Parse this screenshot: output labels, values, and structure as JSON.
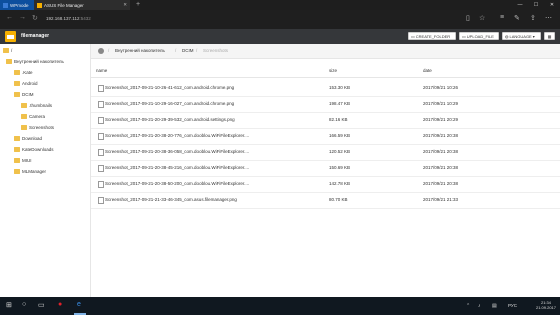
{
  "browser": {
    "tabs": [
      {
        "label": "WPmode"
      },
      {
        "label": "ASUS File Manager"
      }
    ],
    "url": {
      "host": "192.168.137.112",
      "port": ":5432"
    }
  },
  "app": {
    "name": "filemanager",
    "buttons": {
      "create_folder": "CREATE_FOLDER",
      "upload_file": "UPLOAD_FILE",
      "language": "LANGUAGE"
    }
  },
  "sidebar": {
    "root": "/",
    "items": [
      {
        "label": "Внутренний накопитель"
      },
      {
        "label": ".Kate"
      },
      {
        "label": "Android"
      },
      {
        "label": "DCIM"
      },
      {
        "label": ".thumbnails"
      },
      {
        "label": "Camera"
      },
      {
        "label": "Screenshots"
      },
      {
        "label": "Download"
      },
      {
        "label": "KateDownloads"
      },
      {
        "label": "MIUI"
      },
      {
        "label": "MLManager"
      }
    ]
  },
  "breadcrumb": [
    "Внутренний накопитель",
    "DCIM",
    "Screenshots"
  ],
  "table": {
    "headers": {
      "name": "name",
      "size": "size",
      "date": "date"
    },
    "rows": [
      {
        "name": "Screenshot_2017-09-21-10-26-41-612_com.android.chrome.png",
        "size": "153.30 KB",
        "date": "2017/09/21 10:26"
      },
      {
        "name": "Screenshot_2017-09-21-10-29-16-027_com.android.chrome.png",
        "size": "198.47 KB",
        "date": "2017/09/21 10:29"
      },
      {
        "name": "Screenshot_2017-09-21-20-29-39-532_com.android.settings.png",
        "size": "82.16 KB",
        "date": "2017/09/21 20:29"
      },
      {
        "name": "Screenshot_2017-09-21-20-38-20-776_com.dooblou.WiFiFileExplorer....",
        "size": "166.59 KB",
        "date": "2017/09/21 20:38"
      },
      {
        "name": "Screenshot_2017-09-21-20-38-36-058_com.dooblou.WiFiFileExplorer....",
        "size": "120.52 KB",
        "date": "2017/09/21 20:38"
      },
      {
        "name": "Screenshot_2017-09-21-20-38-45-216_com.dooblou.WiFiFileExplorer....",
        "size": "150.69 KB",
        "date": "2017/09/21 20:38"
      },
      {
        "name": "Screenshot_2017-09-21-20-38-50-200_com.dooblou.WiFiFileExplorer....",
        "size": "142.78 KB",
        "date": "2017/09/21 20:38"
      },
      {
        "name": "Screenshot_2017-09-21-21-33-46-345_com.asus.filemanager.png",
        "size": "80.70 KB",
        "date": "2017/09/21 21:33"
      }
    ]
  },
  "taskbar": {
    "lang": "РУС",
    "time": "21:34",
    "date": "21.09.2017"
  },
  "colors": {
    "accent": "#f6b000",
    "header": "#35373a",
    "taskbar": "#101820"
  }
}
